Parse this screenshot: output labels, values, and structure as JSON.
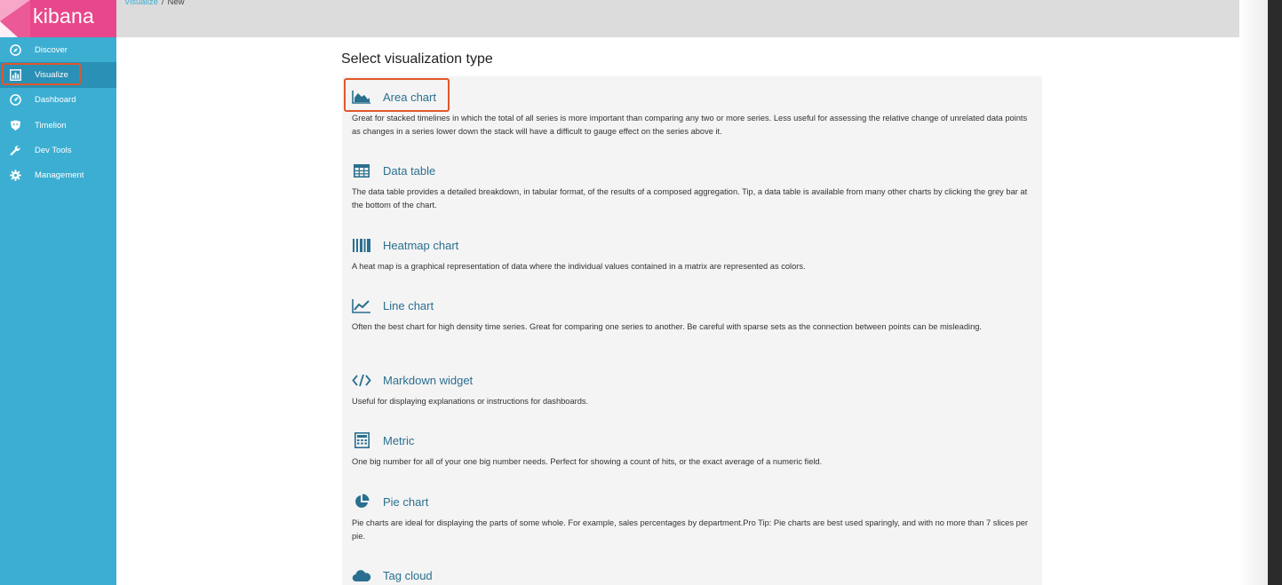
{
  "brand": {
    "name": "kibana"
  },
  "breadcrumb": {
    "parent": "Visualize",
    "separator": "/",
    "current": "New"
  },
  "sidebar": {
    "items": [
      {
        "label": "Discover",
        "icon": "compass-icon"
      },
      {
        "label": "Visualize",
        "icon": "bar-chart-icon",
        "active": true
      },
      {
        "label": "Dashboard",
        "icon": "gauge-icon"
      },
      {
        "label": "Timelion",
        "icon": "shield-icon"
      },
      {
        "label": "Dev Tools",
        "icon": "wrench-icon"
      },
      {
        "label": "Management",
        "icon": "gear-icon"
      }
    ]
  },
  "main": {
    "title": "Select visualization type",
    "types": [
      {
        "label": "Area chart",
        "icon": "area-chart-icon",
        "description": "Great for stacked timelines in which the total of all series is more important than comparing any two or more series. Less useful for assessing the relative change of unrelated data points as changes in a series lower down the stack will have a difficult to gauge effect on the series above it."
      },
      {
        "label": "Data table",
        "icon": "table-icon",
        "description": "The data table provides a detailed breakdown, in tabular format, of the results of a composed aggregation. Tip, a data table is available from many other charts by clicking the grey bar at the bottom of the chart."
      },
      {
        "label": "Heatmap chart",
        "icon": "heatmap-icon",
        "description": "A heat map is a graphical representation of data where the individual values contained in a matrix are represented as colors."
      },
      {
        "label": "Line chart",
        "icon": "line-chart-icon",
        "description": "Often the best chart for high density time series. Great for comparing one series to another. Be careful with sparse sets as the connection between points can be misleading."
      },
      {
        "label": "Markdown widget",
        "icon": "code-icon",
        "description": "Useful for displaying explanations or instructions for dashboards."
      },
      {
        "label": "Metric",
        "icon": "calculator-icon",
        "description": "One big number for all of your one big number needs. Perfect for showing a count of hits, or the exact average of a numeric field."
      },
      {
        "label": "Pie chart",
        "icon": "pie-chart-icon",
        "description": "Pie charts are ideal for displaying the parts of some whole. For example, sales percentages by department.Pro Tip: Pie charts are best used sparingly, and with no more than 7 slices per pie."
      },
      {
        "label": "Tag cloud",
        "icon": "cloud-icon",
        "description": ""
      }
    ]
  },
  "colors": {
    "sidebar": "#3caed2",
    "sidebar_active": "#2a90b5",
    "logo_bg": "#e8488b",
    "highlight": "#e2572b",
    "link": "#2a6f8f"
  }
}
